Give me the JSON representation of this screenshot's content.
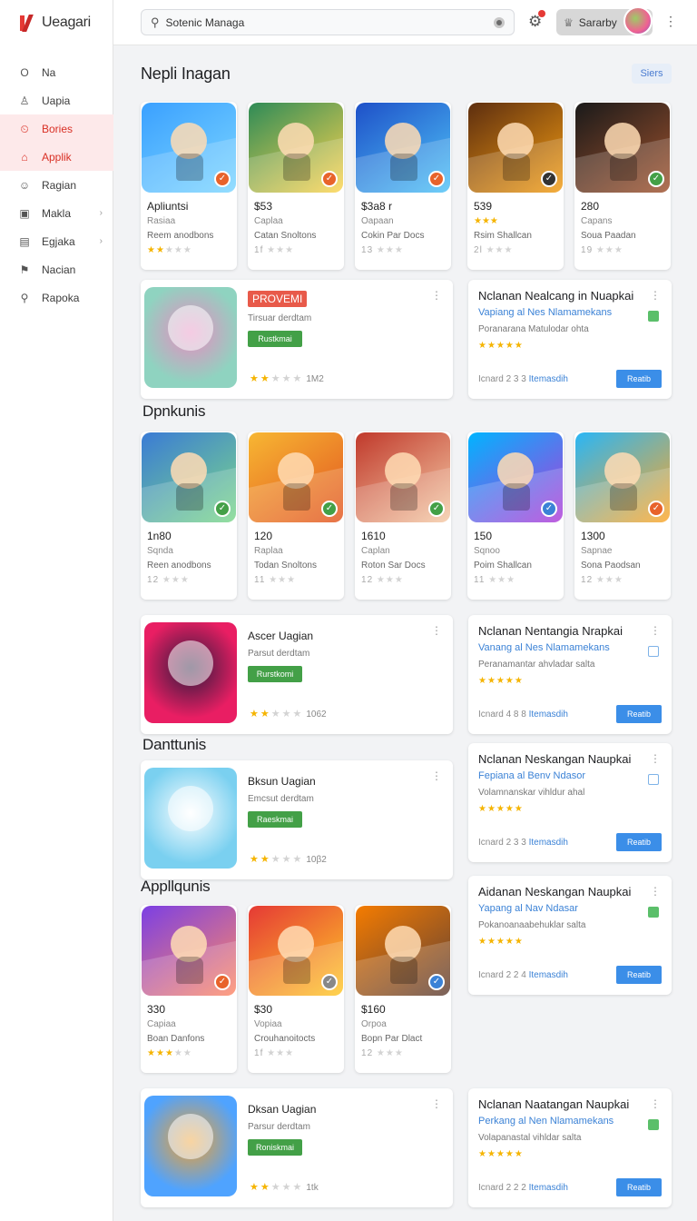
{
  "app": {
    "logo_text": "Ueagari"
  },
  "sidebar": {
    "items": [
      {
        "label": "Na",
        "icon": "O"
      },
      {
        "label": "Uapia",
        "icon": "♙"
      },
      {
        "label": "Bories",
        "icon": "⏲"
      },
      {
        "label": "Applik",
        "icon": "⌂"
      },
      {
        "label": "Ragian",
        "icon": "☺"
      },
      {
        "label": "Makla",
        "icon": "▣"
      },
      {
        "label": "Egjaka",
        "icon": "▤"
      },
      {
        "label": "Nacian",
        "icon": "⚑"
      },
      {
        "label": "Rapoka",
        "icon": "⚲"
      }
    ]
  },
  "topbar": {
    "search_value": "Sotenic Managa",
    "user_label": "Sararby"
  },
  "sections": {
    "s1": "Nepli Inagan",
    "s2": "Dpnkunis",
    "s3": "Danttunis",
    "s4": "Appllqunis",
    "pill": "Siers"
  },
  "row1": [
    {
      "l1": "Apliuntsi",
      "l2": "Rasiaa",
      "l3": "Reem anodbons",
      "stars": "★★★★★",
      "on": 2,
      "colors": [
        "#3aa0ff",
        "#7cd6ff"
      ],
      "badge": "#e8632b"
    },
    {
      "l1": "$53",
      "l2": "Caplaa",
      "l3": "Catan Snoltons",
      "stars": "1f ★★★",
      "on": 0,
      "colors": [
        "#2e8b57",
        "#ffd54f"
      ],
      "badge": "#e8632b"
    },
    {
      "l1": "$3a8 r",
      "l2": "Oapaan",
      "l3": "Cokin Par Docs",
      "stars": "13 ★★★",
      "on": 0,
      "colors": [
        "#1e50c8",
        "#4fc3f7"
      ],
      "badge": "#e8632b"
    },
    {
      "l1": "539",
      "l2": "★★★",
      "l3": "Rsim Shallcan",
      "stars": "2l ★★★",
      "on": 0,
      "colors": [
        "#5d2e0f",
        "#f39c12"
      ],
      "badge": "#333"
    },
    {
      "l1": "280",
      "l2": "Capans",
      "l3": "Soua Paadan",
      "stars": "19 ★★★",
      "on": 0,
      "colors": [
        "#1a1a1a",
        "#a0522d"
      ],
      "badge": "#43a047"
    }
  ],
  "row2": [
    {
      "l1": "1n80",
      "l2": "Sqnda",
      "l3": "Reen anodbons",
      "stars": "12 ★★★",
      "on": 0,
      "colors": [
        "#3a7bd5",
        "#7cd88a"
      ],
      "badge": "#43a047"
    },
    {
      "l1": "120",
      "l2": "Raplaa",
      "l3": "Todan Snoltons",
      "stars": "11 ★★★",
      "on": 0,
      "colors": [
        "#f7b733",
        "#e2541f"
      ],
      "badge": "#43a047"
    },
    {
      "l1": "1610",
      "l2": "Caplan",
      "l3": "Roton Sar Docs",
      "stars": "12 ★★★",
      "on": 0,
      "colors": [
        "#c0392b",
        "#f5cba7"
      ],
      "badge": "#43a047"
    },
    {
      "l1": "150",
      "l2": "Sqnoo",
      "l3": "Poim Shallcan",
      "stars": "11 ★★★",
      "on": 0,
      "colors": [
        "#00b4ff",
        "#b23ad8"
      ],
      "badge": "#3b82d6"
    },
    {
      "l1": "1300",
      "l2": "Sapnae",
      "l3": "Sona Paodsan",
      "stars": "12 ★★★",
      "on": 0,
      "colors": [
        "#29b6f6",
        "#ffa726"
      ],
      "badge": "#e8632b"
    }
  ],
  "row3": [
    {
      "l1": "330",
      "l2": "Capiaa",
      "l3": "Boan Danfons",
      "stars": "★★★★★",
      "on": 3,
      "colors": [
        "#7b3fe4",
        "#ff8a65"
      ],
      "badge": "#e8632b"
    },
    {
      "l1": "$30",
      "l2": "Vopiaa",
      "l3": "Crouhanoitocts",
      "stars": "1f ★★★",
      "on": 0,
      "colors": [
        "#e53935",
        "#ffca28"
      ],
      "badge": "#888"
    },
    {
      "l1": "$160",
      "l2": "Orpoa",
      "l3": "Bopn Par Dlact",
      "stars": "12 ★★★",
      "on": 0,
      "colors": [
        "#f57c00",
        "#5d4037"
      ],
      "badge": "#3b82d6"
    }
  ],
  "wide": [
    {
      "name": "PROVEMI",
      "sub": "Tirsuar derdtam",
      "btn": "Rustkmai",
      "stars": "★★★★★",
      "rnum": "1M2",
      "highlight": true,
      "colors": [
        "#8fd3c0",
        "#e88cc0"
      ]
    },
    {
      "name": "Ascer Uagian",
      "sub": "Parsut derdtam",
      "btn": "Rurstkomi",
      "stars": "★★★★★",
      "rnum": "1062",
      "highlight": false,
      "colors": [
        "#e91e63",
        "#2b1b3d"
      ]
    },
    {
      "name": "Bksun Uagian",
      "sub": "Emcsut derdtam",
      "btn": "Raeskmai",
      "stars": "★★★★★",
      "rnum": "10β2",
      "highlight": false,
      "colors": [
        "#7ad0f0",
        "#ffffff"
      ]
    },
    {
      "name": "Dksan Uagian",
      "sub": "Parsur derdtam",
      "btn": "Roniskmai",
      "stars": "★★★★★",
      "rnum": "1tk",
      "highlight": false,
      "colors": [
        "#4fa3ff",
        "#f0a030"
      ]
    }
  ],
  "side": [
    {
      "title": "Nclanan Nealcang in Nuapkai",
      "link": "Vapiang al Nes Nlamamekans",
      "desc": "Poranarana Matulodar ohta",
      "stars": "★★★★★",
      "foot": "Icnard 2 3 3",
      "foot_link": "Itemasdih",
      "btn": "Reatib",
      "checked": true
    },
    {
      "title": "Nclanan Nentangia Nrapkai",
      "link": "Vanang al Nes Nlamamekans",
      "desc": "Peranamantar ahvladar salta",
      "stars": "★★★★★",
      "foot": "Icnard 4 8 8",
      "foot_link": "Itemasdih",
      "btn": "Reatib",
      "checked": false
    },
    {
      "title": "Nclanan Neskangan Naupkai",
      "link": "Fepiana al Benv Ndasor",
      "desc": "Volamnanskar vihldur ahal",
      "stars": "★★★★★",
      "foot": "Icnard 2 3 3",
      "foot_link": "Itemasdih",
      "btn": "Reatib",
      "checked": false
    },
    {
      "title": "Aidanan Neskangan Naupkai",
      "link": "Yapang al Nav Ndasar",
      "desc": "Pokanoanaabehuklar salta",
      "stars": "★★★★★",
      "foot": "Icnard 2 2 4",
      "foot_link": "Itemasdih",
      "btn": "Reatib",
      "checked": true
    },
    {
      "title": "Nclanan Naatangan Naupkai",
      "link": "Perkang al Nen Nlamamekans",
      "desc": "Volapanastal vihldar salta",
      "stars": "★★★★★",
      "foot": "Icnard 2 2 2",
      "foot_link": "Itemasdih",
      "btn": "Reatib",
      "checked": true
    }
  ]
}
